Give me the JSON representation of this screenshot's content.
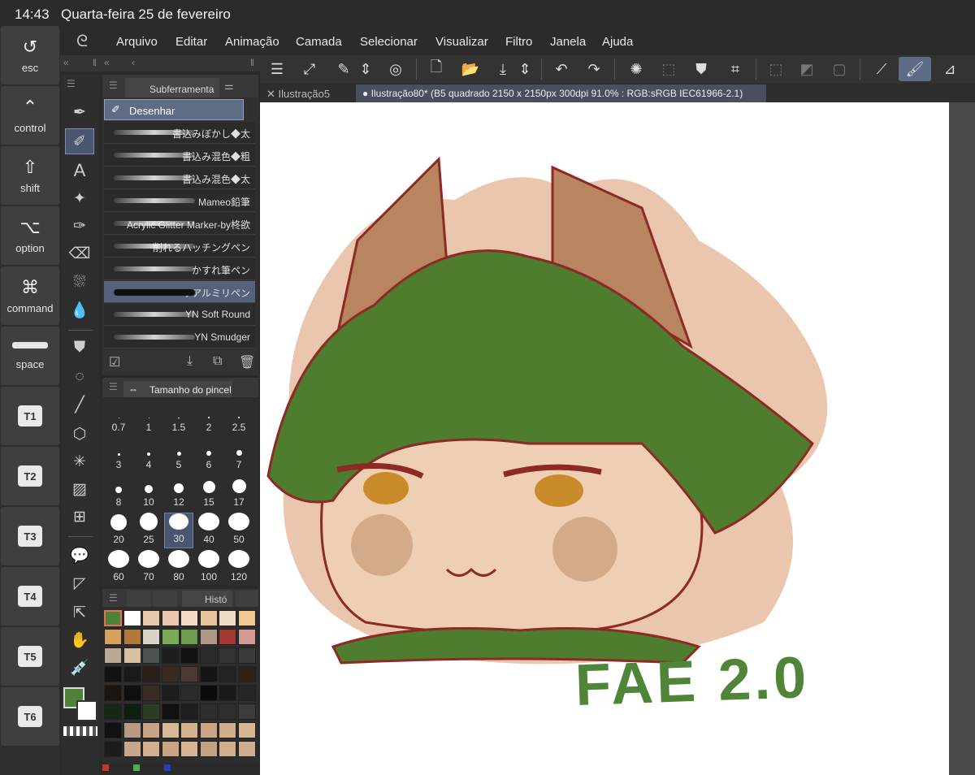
{
  "status_bar": {
    "time": "14:43",
    "date": "Quarta-feira 25 de fevereiro"
  },
  "modifier_keys": [
    {
      "label": "esc",
      "icon": "undo-arrow-icon"
    },
    {
      "label": "control",
      "icon": "caret-up-icon"
    },
    {
      "label": "shift",
      "icon": "shift-arrow-icon"
    },
    {
      "label": "option",
      "icon": "option-key-icon"
    },
    {
      "label": "command",
      "icon": "command-key-icon"
    },
    {
      "label": "space",
      "icon": "spacebar-icon"
    }
  ],
  "shortcut_keys": [
    "T1",
    "T2",
    "T3",
    "T4",
    "T5",
    "T6"
  ],
  "menu": [
    "Arquivo",
    "Editar",
    "Animação",
    "Camada",
    "Selecionar",
    "Visualizar",
    "Filtro",
    "Janela",
    "Ajuda"
  ],
  "doc_tabs": [
    {
      "label": "Ilustração5",
      "active": false
    },
    {
      "label": "Ilustração80* (B5 quadrado 2150 x 2150px 300dpi 91.0% : RGB:sRGB IEC61966-2.1)",
      "active": true
    }
  ],
  "subtool": {
    "tab_label": "Subferramenta",
    "group": "Desenhar",
    "brushes": [
      "書込みぼかし◆太",
      "書込み混色◆粗",
      "書込み混色◆太",
      "Mameo鉛筆",
      "Acrylic Glitter Marker-by柊欲",
      "削れるハッチングペン",
      "かすれ筆ペン",
      "リアルミリペン",
      "YN Soft Round",
      "YN Smudger"
    ],
    "selected_index": 7
  },
  "brush_size": {
    "tab_label": "Tamanho do pincel",
    "sizes": [
      "0.7",
      "1",
      "1.5",
      "2",
      "2.5",
      "3",
      "4",
      "5",
      "6",
      "7",
      "8",
      "10",
      "12",
      "15",
      "17",
      "20",
      "25",
      "30",
      "40",
      "50",
      "60",
      "70",
      "80",
      "100",
      "120"
    ],
    "selected": "30"
  },
  "color_panel": {
    "tab_label": "Histó"
  },
  "colors": {
    "main": "#4f8236",
    "sub": "#ffffff",
    "accent": "#5d6c86"
  },
  "palette": [
    [
      "#4f8236",
      "#ffffff",
      "#e8c9aa",
      "#ecc7b0",
      "#f3d9c6",
      "#e6c39d",
      "#efdcc6",
      "#f0c890"
    ],
    [
      "#d6a15a",
      "#b07a3a",
      "#d9d3c8",
      "#7aab5a",
      "#6c9d4e",
      "#b09886",
      "#a33a32",
      "#d39a94"
    ],
    [
      "#b9a894",
      "#d8c0a0",
      "#4d5352",
      "#1e1e1e",
      "#111111",
      "#2a2a2a",
      "#333333",
      "#3a3a3a"
    ],
    [
      "#121212",
      "#1a1a1a",
      "#2a1e18",
      "#3a2a22",
      "#4a3a32",
      "#151515",
      "#222222",
      "#2e2118"
    ],
    [
      "#1b1410",
      "#0f0f0f",
      "#3a2c24",
      "#1d1d1d",
      "#2b2b2b",
      "#0b0b0b",
      "#191919",
      "#262626"
    ],
    [
      "#172716",
      "#0f1f0f",
      "#2b3d22",
      "#101010",
      "#1f1f1f",
      "#2d2d2d",
      "#2f2f2f",
      "#3c3c3c"
    ],
    [
      "#111111",
      "#b89a84",
      "#caa387",
      "#d8b896",
      "#d5b28e",
      "#c9a583",
      "#d0ad8b",
      "#d6b594"
    ],
    [
      "#1c1c1c",
      "#c8a68c",
      "#d2b08f",
      "#caa380",
      "#d7b593",
      "#c4a281",
      "#d1ae8c",
      "#cfae8f"
    ]
  ],
  "canvas": {
    "signature": "FAE 2.0"
  }
}
